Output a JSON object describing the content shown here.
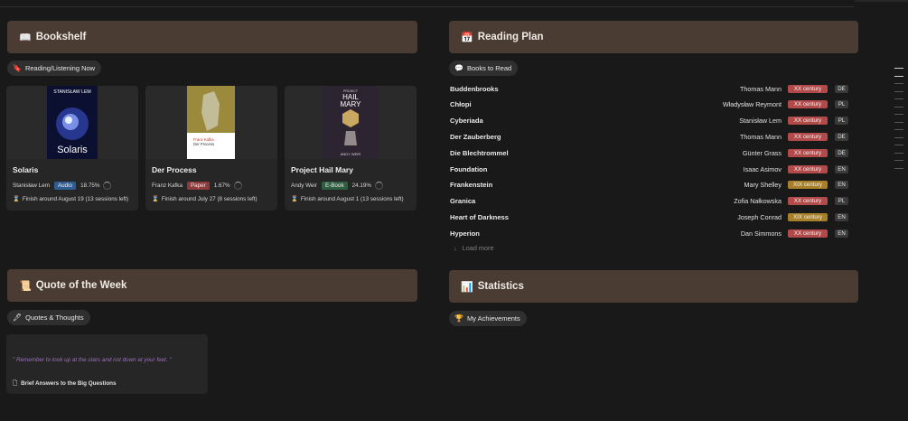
{
  "bookshelf": {
    "header": {
      "icon": "📖",
      "title": "Bookshelf"
    },
    "pill": {
      "icon": "🔖",
      "label": "Reading/Listening Now"
    },
    "books": [
      {
        "title": "Solaris",
        "author": "Stanisław Lem",
        "format": "Audio",
        "format_color": "#2f5d93",
        "progress": "18.75%",
        "finish": "Finish around August 19 (13 sessions left)"
      },
      {
        "title": "Der Process",
        "author": "Franz Kafka",
        "format": "Paper",
        "format_color": "#8c3a3a",
        "progress": "1.67%",
        "finish": "Finish around July 27 (8 sessions left)"
      },
      {
        "title": "Project Hail Mary",
        "author": "Andy Weir",
        "format": "E-Book",
        "format_color": "#2f5e43",
        "progress": "24.19%",
        "finish": "Finish around August 1 (13 sessions left)"
      }
    ],
    "covers": {
      "solaris": {
        "author": "STANISŁAW LEM",
        "title": "Solaris"
      },
      "process": {
        "author": "Franz Kafka",
        "title": "Der Process"
      },
      "hailmary": {
        "top": "PROJECT",
        "title1": "HAIL",
        "title2": "MARY",
        "author": "ANDY WEIR"
      }
    }
  },
  "reading_plan": {
    "header": {
      "icon": "📅",
      "title": "Reading Plan"
    },
    "pill": {
      "icon": "💬",
      "label": "Books to Read"
    },
    "rows": [
      {
        "title": "Buddenbrooks",
        "author": "Thomas Mann",
        "century": "XX century",
        "lang": "DE"
      },
      {
        "title": "Chłopi",
        "author": "Władysław Reymont",
        "century": "XX century",
        "lang": "PL"
      },
      {
        "title": "Cyberiada",
        "author": "Stanisław Lem",
        "century": "XX century",
        "lang": "PL"
      },
      {
        "title": "Der Zauberberg",
        "author": "Thomas Mann",
        "century": "XX century",
        "lang": "DE"
      },
      {
        "title": "Die Blechtrommel",
        "author": "Günter Grass",
        "century": "XX century",
        "lang": "DE"
      },
      {
        "title": "Foundation",
        "author": "Isaac Asimov",
        "century": "XX century",
        "lang": "EN"
      },
      {
        "title": "Frankenstein",
        "author": "Mary Shelley",
        "century": "XIX century",
        "lang": "EN"
      },
      {
        "title": "Granica",
        "author": "Zofia Nałkowska",
        "century": "XX century",
        "lang": "PL"
      },
      {
        "title": "Heart of Darkness",
        "author": "Joseph Conrad",
        "century": "XIX century",
        "lang": "EN"
      },
      {
        "title": "Hyperion",
        "author": "Dan Simmons",
        "century": "XX century",
        "lang": "EN"
      }
    ],
    "century_colors": {
      "XX century": "#b24a4a",
      "XIX century": "#a8802a"
    },
    "load_more": "Load more"
  },
  "quote": {
    "header": {
      "icon": "📜",
      "title": "Quote of the Week"
    },
    "pill": {
      "icon": "🖋",
      "label": "Quotes & Thoughts"
    },
    "text": "\" Remember to look up at the stars and not down at your feet. \"",
    "source": "Brief Answers to the Big Questions"
  },
  "statistics": {
    "header": {
      "icon": "📊",
      "title": "Statistics"
    },
    "pill": {
      "icon": "🏆",
      "label": "My Achievements"
    }
  }
}
